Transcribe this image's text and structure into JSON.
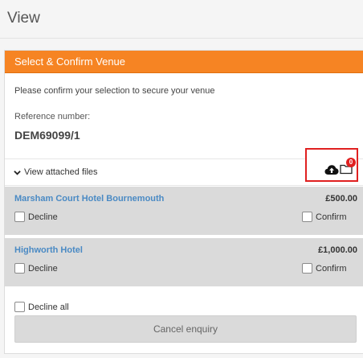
{
  "page": {
    "title": "View"
  },
  "panel": {
    "header": "Select & Confirm Venue",
    "intro": "Please confirm your selection to secure your venue",
    "reference_label": "Reference number:",
    "reference_value": "DEM69099/1"
  },
  "files": {
    "toggle_label": "View attached files",
    "badge_count": "0",
    "icons": [
      "chevron-down-icon",
      "cloud-upload-icon",
      "folder-icon"
    ]
  },
  "venues": [
    {
      "name": "Marsham Court Hotel Bournemouth",
      "price": "£500.00",
      "decline_label": "Decline",
      "confirm_label": "Confirm"
    },
    {
      "name": "Highworth Hotel",
      "price": "£1,000.00",
      "decline_label": "Decline",
      "confirm_label": "Confirm"
    }
  ],
  "actions": {
    "decline_all_label": "Decline all",
    "cancel_label": "Cancel enquiry"
  },
  "colors": {
    "header_orange": "#f68423",
    "venue_link_blue": "#4a8ac4",
    "badge_red": "#e02020",
    "venue_bg": "#dadada"
  }
}
